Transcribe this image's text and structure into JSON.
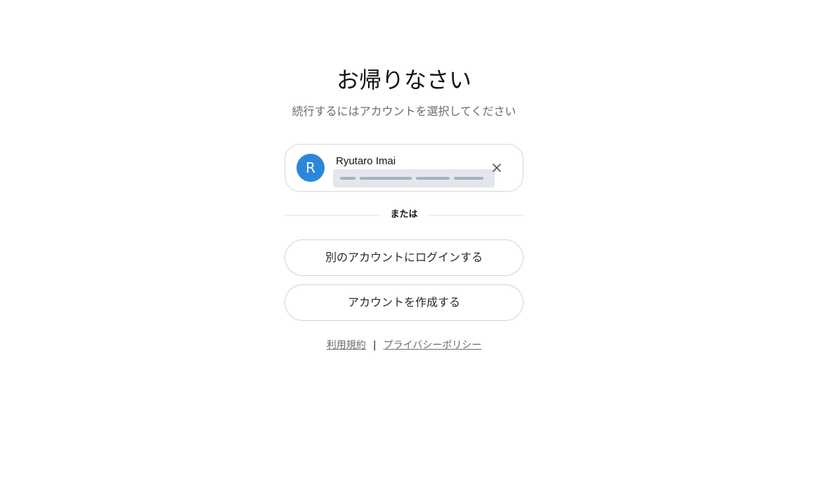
{
  "header": {
    "title": "お帰りなさい",
    "subtitle": "続行するにはアカウントを選択してください"
  },
  "account": {
    "avatar_initial": "R",
    "avatar_color": "#2b87d9",
    "name": "Ryutaro Imai",
    "remove_icon": "close-icon"
  },
  "divider": {
    "label": "または"
  },
  "actions": {
    "login_other_label": "別のアカウントにログインする",
    "create_account_label": "アカウントを作成する"
  },
  "footer": {
    "terms_label": "利用規約",
    "separator": "|",
    "privacy_label": "プライバシーポリシー"
  }
}
